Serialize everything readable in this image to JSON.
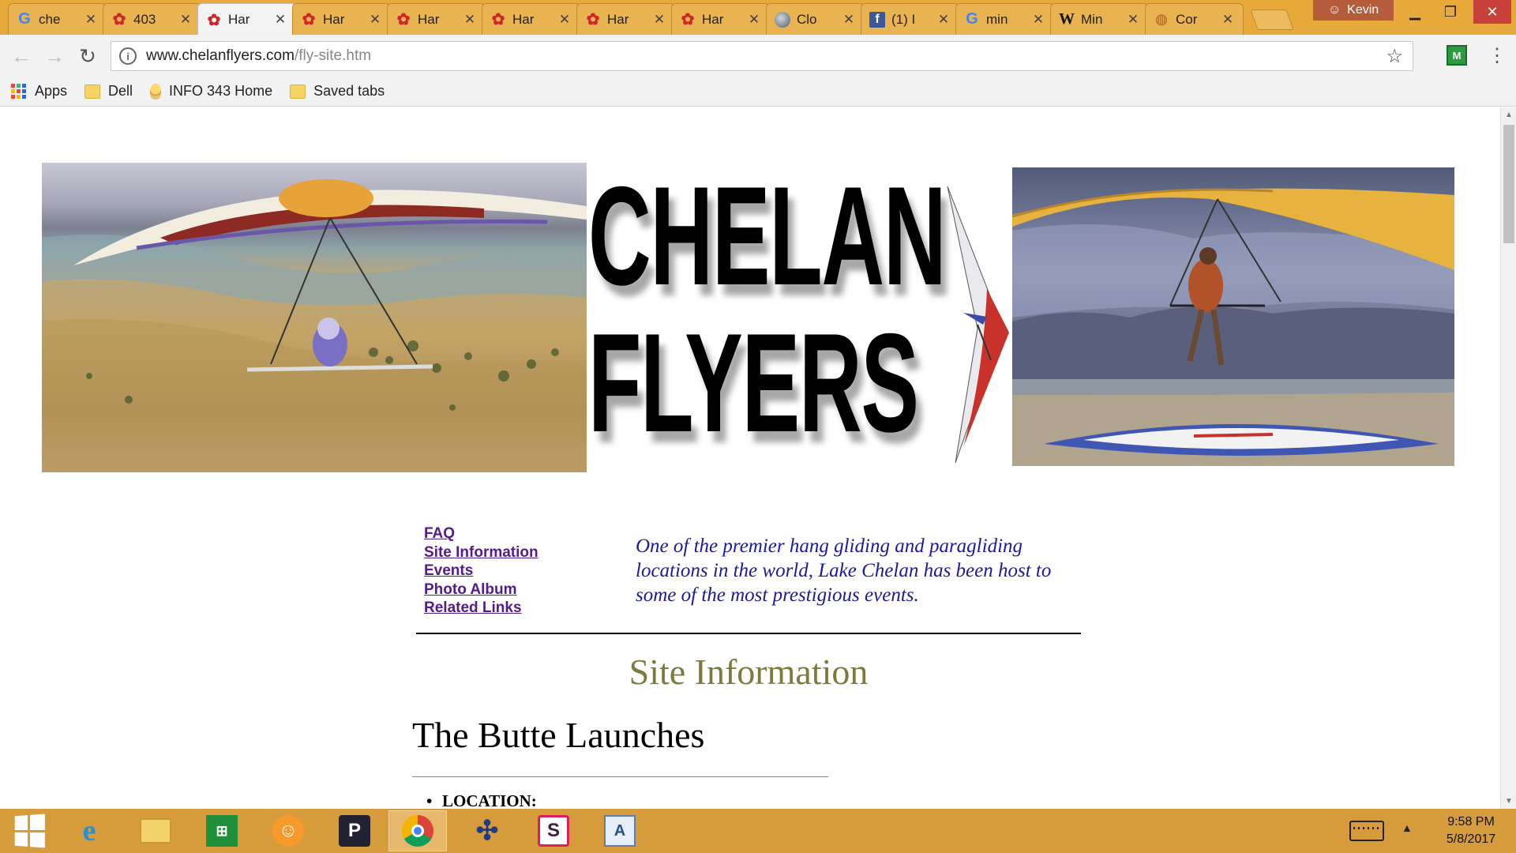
{
  "browser": {
    "tabs": [
      {
        "title": "che",
        "icon": "google-g-icon",
        "active": false
      },
      {
        "title": "403",
        "icon": "flower-icon",
        "active": false
      },
      {
        "title": "Har",
        "icon": "flower-icon",
        "active": true
      },
      {
        "title": "Har",
        "icon": "flower-icon",
        "active": false
      },
      {
        "title": "Har",
        "icon": "flower-icon",
        "active": false
      },
      {
        "title": "Har",
        "icon": "flower-icon",
        "active": false
      },
      {
        "title": "Har",
        "icon": "flower-icon",
        "active": false
      },
      {
        "title": "Har",
        "icon": "flower-icon",
        "active": false
      },
      {
        "title": "Clo",
        "icon": "globe-icon",
        "active": false
      },
      {
        "title": "(1) I",
        "icon": "facebook-icon",
        "active": false
      },
      {
        "title": "min",
        "icon": "google-g-icon",
        "active": false
      },
      {
        "title": "Min",
        "icon": "wikipedia-icon",
        "active": false
      },
      {
        "title": "Cor",
        "icon": "leaf-icon",
        "active": false
      }
    ],
    "profile_name": "Kevin",
    "url_host": "www.chelanflyers.com",
    "url_path": "/fly-site.htm",
    "bookmarks": [
      {
        "label": "Apps",
        "icon": "apps-grid-icon"
      },
      {
        "label": "Dell",
        "icon": "folder-icon"
      },
      {
        "label": "INFO 343 Home",
        "icon": "lightbulb-icon"
      },
      {
        "label": "Saved tabs",
        "icon": "folder-icon"
      }
    ]
  },
  "page": {
    "logo_line1": "CHELAN",
    "logo_line2": "FLYERS",
    "nav_links": [
      "FAQ",
      "Site Information",
      "Events",
      "Photo Album",
      "Related Links"
    ],
    "tagline": "One of the premier hang gliding and paragliding locations in the world, Lake Chelan has been host to some of the most prestigious events.",
    "section_title": "Site Information",
    "heading": "The Butte Launches",
    "list_item": "LOCATION:"
  },
  "taskbar": {
    "apps": [
      "start-icon",
      "internet-explorer-icon",
      "file-explorer-icon",
      "store-icon",
      "scratch-icon",
      "pandora-icon",
      "chrome-icon",
      "tableau-icon",
      "slack-icon",
      "wordpad-icon"
    ],
    "clock_time": "9:58 PM",
    "clock_date": "5/8/2017"
  },
  "colors": {
    "tabstrip": "#e7a93a",
    "taskbar": "#d69c3b",
    "link_visited": "#551a8b",
    "tagline": "#1a1a9c",
    "section_title": "#7b7b3e"
  }
}
